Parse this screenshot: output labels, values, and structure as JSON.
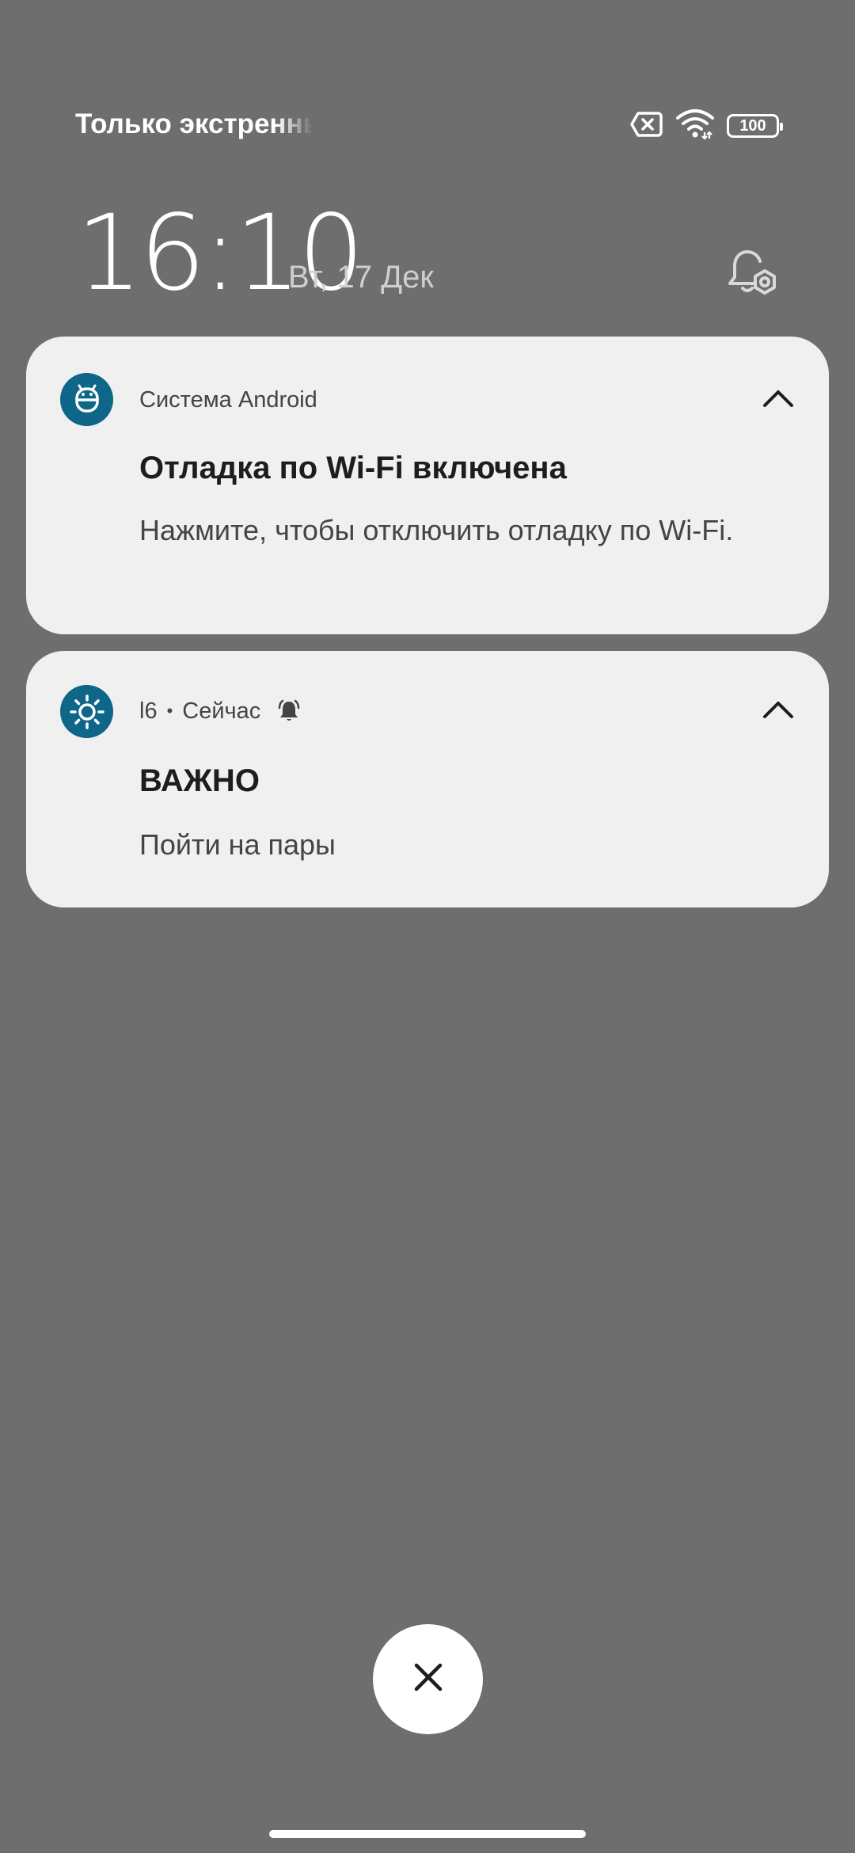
{
  "status_bar": {
    "carrier_text": "Только экстренные",
    "icons": [
      "no-sim-icon",
      "wifi-icon",
      "battery-icon"
    ],
    "battery_level": "100"
  },
  "lockscreen": {
    "time": "16:10",
    "date": "Вт, 17 Дек",
    "icon": "bell-settings-icon"
  },
  "notifications": [
    {
      "app_icon": "android-icon",
      "app_name": "Система Android",
      "title": "Отладка по Wi-Fi включена",
      "text": "Нажмите, чтобы отключить отладку по Wi-Fi.",
      "expand_icon": "chevron-up-icon"
    },
    {
      "app_icon": "sun-icon",
      "app_name": "l6",
      "separator": "•",
      "time": "Сейчас",
      "alert_icon": "bell-icon",
      "title": "ВАЖНО",
      "text": "Пойти на пары",
      "expand_icon": "chevron-up-icon"
    }
  ],
  "dismiss_all": {
    "icon": "close-icon"
  },
  "colors": {
    "background": "#6e6e6e",
    "card": "#f0f0f1",
    "app_icon": "#0e6688",
    "text_primary": "#1d1d1d",
    "text_secondary": "#444444"
  }
}
